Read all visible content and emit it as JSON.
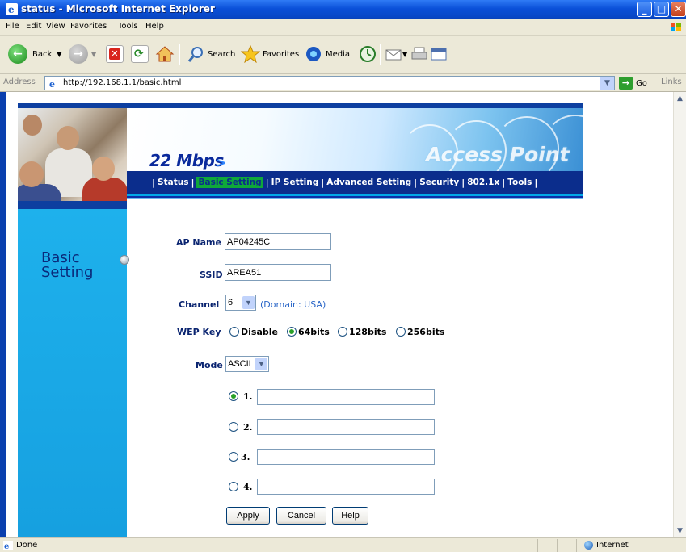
{
  "window": {
    "title": "status - Microsoft Internet Explorer"
  },
  "menu": {
    "items": [
      "File",
      "Edit",
      "View",
      "Favorites",
      "Tools",
      "Help"
    ]
  },
  "toolbar": {
    "back_label": "Back",
    "search_label": "Search",
    "favorites_label": "Favorites",
    "media_label": "Media"
  },
  "address": {
    "label": "Address",
    "url": "http://192.168.1.1/basic.html",
    "go_label": "Go",
    "links_label": "Links"
  },
  "banner": {
    "speed": "22 Mbps",
    "speed_arrow": ">",
    "product": "Access Point"
  },
  "nav": {
    "items": [
      "Status",
      "Basic Setting",
      "IP Setting",
      "Advanced Setting",
      "Security",
      "802.1x",
      "Tools"
    ],
    "active": "Basic Setting"
  },
  "panel": {
    "title": "Basic Setting"
  },
  "form": {
    "ap_name_label": "AP Name",
    "ap_name_value": "AP04245C",
    "ssid_label": "SSID",
    "ssid_value": "AREA51",
    "channel_label": "Channel",
    "channel_value": "6",
    "domain_hint": "(Domain: USA)",
    "wep_label": "WEP Key",
    "wep_options": [
      "Disable",
      "64bits",
      "128bits",
      "256bits"
    ],
    "wep_selected": "64bits",
    "mode_label": "Mode",
    "mode_value": "ASCII",
    "keys": [
      {
        "label": "1.",
        "value": "",
        "selected": true
      },
      {
        "label": "2.",
        "value": "",
        "selected": false
      },
      {
        "label": "3.",
        "value": "",
        "selected": false
      },
      {
        "label": "4.",
        "value": "",
        "selected": false
      }
    ],
    "apply_label": "Apply",
    "cancel_label": "Cancel",
    "help_label": "Help"
  },
  "statusbar": {
    "status": "Done",
    "zone": "Internet"
  },
  "colors": {
    "nav_bg": "#0b2d8c",
    "nav_active": "#0fa83a",
    "panel_bg": "#1eb1ec",
    "label_color": "#0a2470"
  }
}
